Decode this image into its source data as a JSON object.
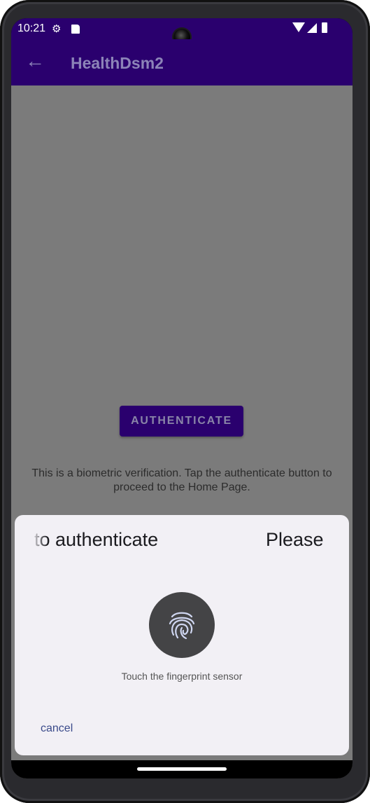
{
  "status_bar": {
    "time": "10:21"
  },
  "app_bar": {
    "title": "HealthDsm2",
    "back_icon": "arrow-left-icon"
  },
  "main": {
    "authenticate_button": "AUTHENTICATE",
    "info_text": "This is a biometric verification. Tap the authenticate button to proceed to the Home Page."
  },
  "biometric_dialog": {
    "title_part_1": "to authenticate",
    "title_part_2": "Please",
    "fingerprint_icon": "fingerprint-icon",
    "caption": "Touch the fingerprint sensor",
    "cancel": "cancel"
  },
  "colors": {
    "app_bar": "#2a006e",
    "scrim": "#7b7b7b",
    "dialog_bg": "#f2f0f5",
    "fingerprint_circle": "#444446"
  }
}
